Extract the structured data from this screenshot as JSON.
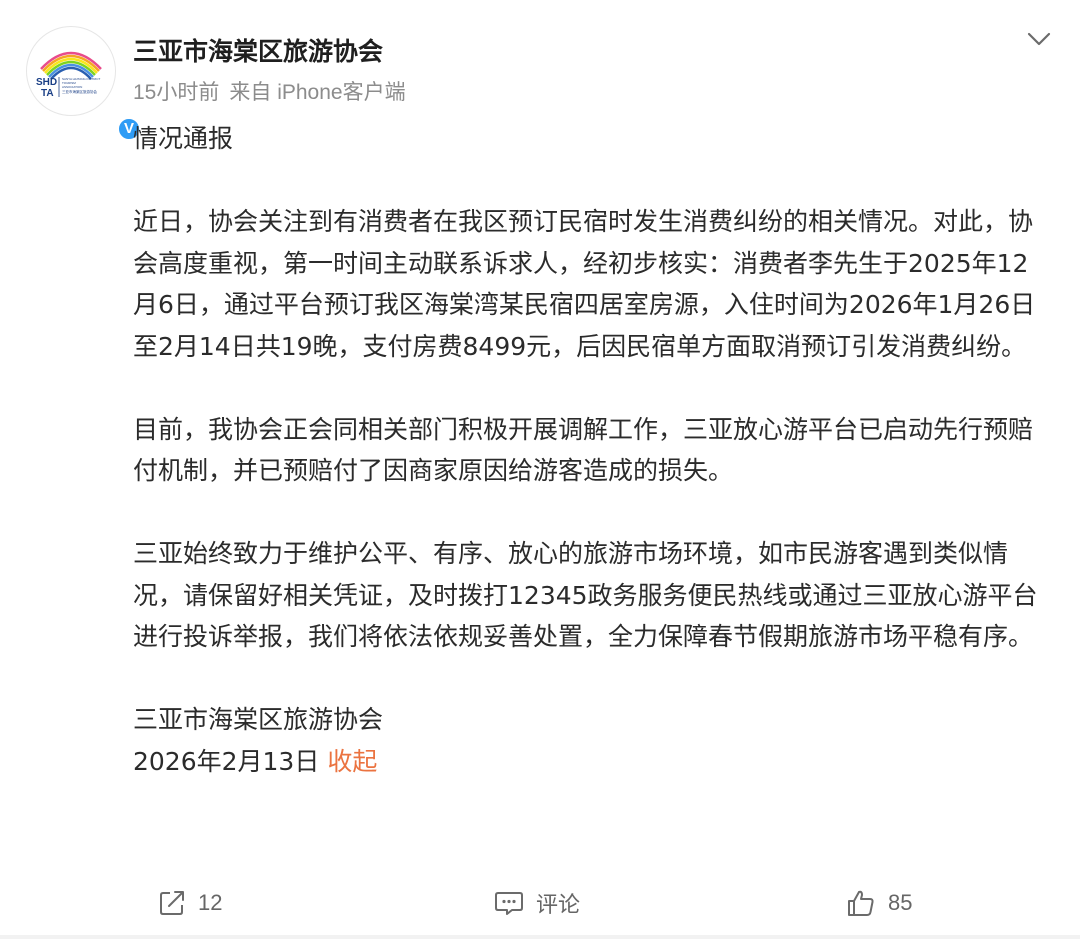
{
  "post": {
    "author": "三亚市海棠区旅游协会",
    "time": "15小时前",
    "source": "来自 iPhone客户端",
    "avatar": {
      "logo_text_top": "SHD",
      "logo_text_bottom": "TA",
      "logo_small_lines": [
        "SANYA HAITANG DISTRICT",
        "TOURISM",
        "ASSOCIATION",
        "三亚市海棠区旅游协会"
      ],
      "verified_badge": "V"
    },
    "paragraphs": [
      "情况通报",
      "近日，协会关注到有消费者在我区预订民宿时发生消费纠纷的相关情况。对此，协会高度重视，第一时间主动联系诉求人，经初步核实：消费者李先生于2025年12月6日，通过平台预订我区海棠湾某民宿四居室房源，入住时间为2026年1月26日至2月14日共19晚，支付房费8499元，后因民宿单方面取消预订引发消费纠纷。",
      "目前，我协会正会同相关部门积极开展调解工作，三亚放心游平台已启动先行预赔付机制，并已预赔付了因商家原因给游客造成的损失。",
      "三亚始终致力于维护公平、有序、放心的旅游市场环境，如市民游客遇到类似情况，请保留好相关凭证，及时拨打12345政务服务便民热线或通过三亚放心游平台进行投诉举报，我们将依法依规妥善处置，全力保障春节假期旅游市场平稳有序。",
      "三亚市海棠区旅游协会"
    ],
    "date_line": "2026年2月13日",
    "collapse_label": "收起"
  },
  "actions": {
    "repost_count": "12",
    "comment_label": "评论",
    "like_count": "85"
  },
  "icons": {
    "menu": "chevron-down-icon",
    "repost": "share-icon",
    "comment": "comment-icon",
    "like": "thumbs-up-icon"
  },
  "colors": {
    "link": "#eb7340",
    "verified": "#2f9cf5",
    "meta": "#8c8c8c"
  }
}
